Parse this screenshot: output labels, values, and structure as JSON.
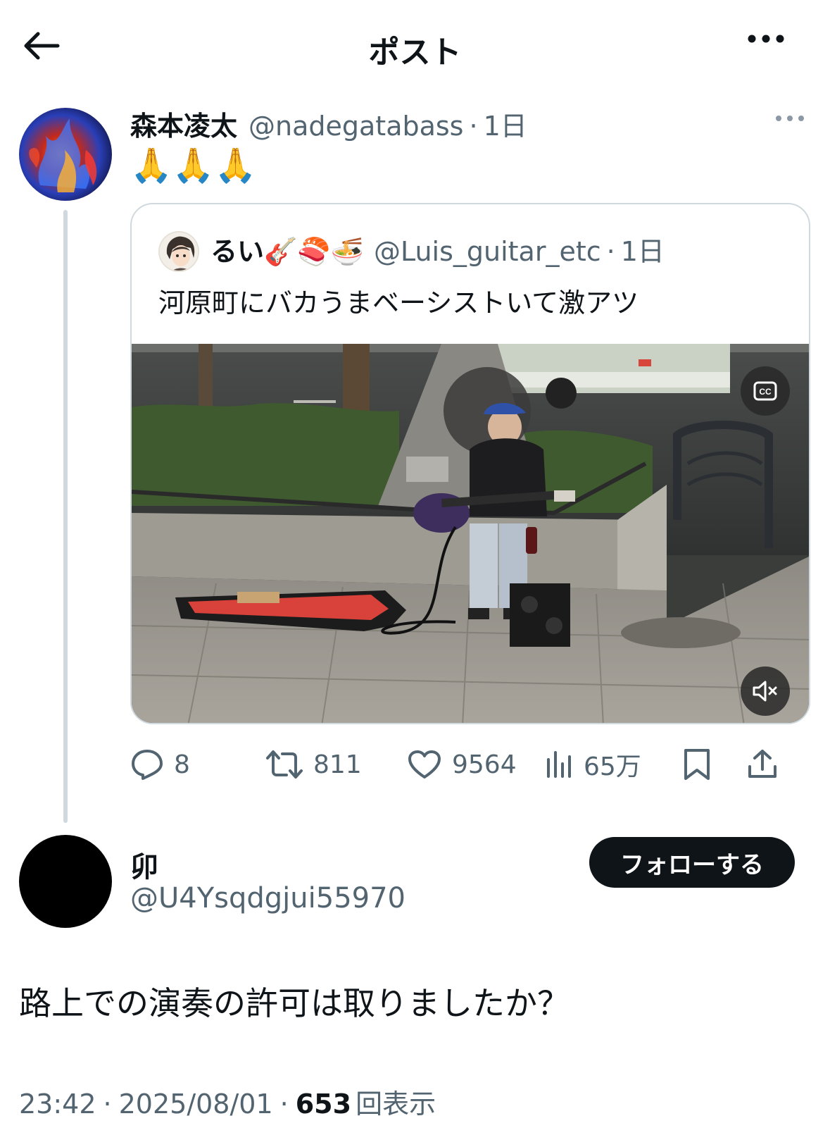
{
  "header": {
    "title": "ポスト"
  },
  "parent": {
    "name": "森本凌太",
    "handle": "@nadegatabass",
    "separator": "·",
    "time": "1日",
    "text": "🙏🙏🙏",
    "quote": {
      "name": "るい🎸🍣🍜",
      "handle": "@Luis_guitar_etc",
      "separator": "·",
      "time": "1日",
      "text": "河原町にバカうまベーシストいて激アツ"
    },
    "actions": {
      "replies": "8",
      "reposts": "811",
      "likes": "9564",
      "views": "65万"
    }
  },
  "reply": {
    "name": "卯",
    "handle": "@U4Ysqdgjui55970",
    "follow_label": "フォローする",
    "text": "路上での演奏の許可は取りましたか？",
    "time": "23:42",
    "separator1": "·",
    "date": "2025/08/01",
    "separator2": "·",
    "views_count": "653",
    "views_label": "回表示"
  },
  "icons": [
    "back-arrow-icon",
    "more-icon",
    "cc-icon",
    "mute-icon",
    "reply-icon",
    "repost-icon",
    "like-icon",
    "views-icon",
    "bookmark-icon",
    "share-icon"
  ]
}
